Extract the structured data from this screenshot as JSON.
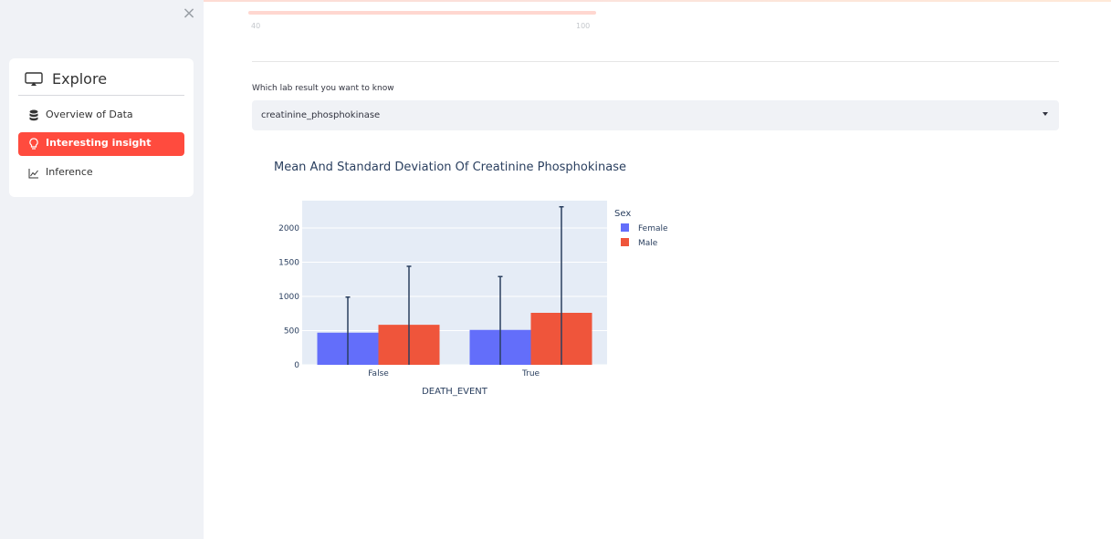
{
  "sidebar": {
    "close_icon": "close-icon",
    "header": {
      "title": "Explore",
      "icon": "tv-icon"
    },
    "items": [
      {
        "label": "Overview of Data",
        "icon": "database-icon",
        "active": false
      },
      {
        "label": "Interesting insight",
        "icon": "lightbulb-icon",
        "active": true
      },
      {
        "label": "Inference",
        "icon": "line-chart-icon",
        "active": false
      }
    ]
  },
  "main": {
    "select": {
      "label": "Which lab result you want to know",
      "value": "creatinine_phosphokinase"
    }
  },
  "colors": {
    "accent": "#ff4b3e",
    "female": "#636efa",
    "male": "#ef553b",
    "plot_bg": "#e5ecf6"
  },
  "chart_data": {
    "type": "bar",
    "title": "Mean And Standard Deviation Of Creatinine Phosphokinase",
    "xlabel": "DEATH_EVENT",
    "ylabel": "",
    "categories": [
      "False",
      "True"
    ],
    "ylim": [
      0,
      2400
    ],
    "yticks": [
      0,
      500,
      1000,
      1500,
      2000
    ],
    "legend_title": "Sex",
    "legend_position": "top-right",
    "series": [
      {
        "name": "Female",
        "values": [
          470,
          510
        ],
        "error": [
          520,
          780
        ]
      },
      {
        "name": "Male",
        "values": [
          585,
          760
        ],
        "error": [
          855,
          1550
        ]
      }
    ]
  }
}
